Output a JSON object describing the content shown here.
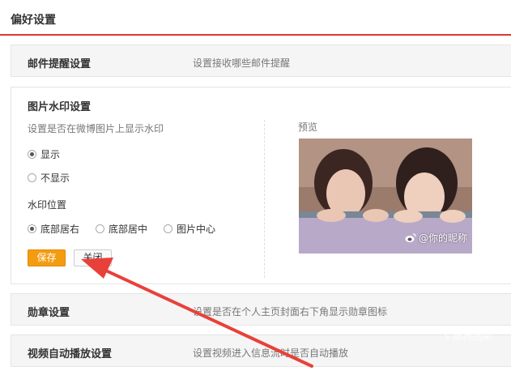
{
  "header": {
    "title": "偏好设置"
  },
  "email_row": {
    "name": "邮件提醒设置",
    "desc": "设置接收哪些邮件提醒"
  },
  "watermark": {
    "title": "图片水印设置",
    "desc": "设置是否在微博图片上显示水印",
    "show_options": [
      {
        "label": "显示",
        "checked": true
      },
      {
        "label": "不显示",
        "checked": false
      }
    ],
    "position_label": "水印位置",
    "positions": [
      {
        "label": "底部居右",
        "checked": true
      },
      {
        "label": "底部居中",
        "checked": false
      },
      {
        "label": "图片中心",
        "checked": false
      }
    ],
    "save_label": "保存",
    "close_label": "关闭",
    "preview_label": "预览",
    "preview_watermark": "@你的昵称"
  },
  "medal_row": {
    "name": "勋章设置",
    "desc": "设置是否在个人主页封面右下角显示勋章图标"
  },
  "video_row": {
    "name": "视频自动播放设置",
    "desc": "设置视频进入信息流时是否自动播放"
  },
  "site_watermark": "s 搜狗指南",
  "colors": {
    "accent": "#e03535",
    "save_button": "#f39c12",
    "arrow": "#e8413a"
  }
}
